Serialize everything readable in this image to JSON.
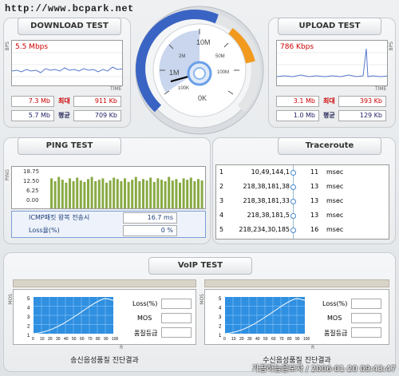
{
  "watermark_url": "http://www.bcpark.net",
  "download": {
    "title": "DOWNLOAD TEST",
    "speed": "5.5 Mbps",
    "axis_bps": "BPS",
    "axis_time": "TIME",
    "cur1": "7.3 Mb",
    "max_label": "최대",
    "max_val": "911 Kb",
    "cur2": "5.7 Mb",
    "avg_label": "평균",
    "avg_val": "709 Kb"
  },
  "upload": {
    "title": "UPLOAD TEST",
    "speed": "786 Kbps",
    "axis_bps": "BPS",
    "axis_time": "TIME",
    "cur1": "3.1 Mb",
    "max_label": "최대",
    "max_val": "393 Kb",
    "cur2": "1.0 Mb",
    "avg_label": "평균",
    "avg_val": "129 Kb"
  },
  "gauge": {
    "ticks": [
      "0K",
      "100K",
      "1M",
      "2M",
      "10M",
      "50M",
      "100M"
    ]
  },
  "ping": {
    "title": "PING TEST",
    "axis": "PING",
    "yticks": [
      "18.75",
      "12.50",
      "6.25",
      "0.00"
    ],
    "icmp_label": "ICMP패킷 왕복 전송시",
    "icmp_value": "16.7 ms",
    "loss_label": "Loss율(%)",
    "loss_value": "0 %"
  },
  "traceroute": {
    "title": "Traceroute",
    "rows": [
      {
        "n": "1",
        "ip": "10,49,144,1",
        "ms": "11",
        "unit": "msec"
      },
      {
        "n": "2",
        "ip": "218,38,181,38",
        "ms": "13",
        "unit": "msec"
      },
      {
        "n": "3",
        "ip": "218,38,181,33",
        "ms": "13",
        "unit": "msec"
      },
      {
        "n": "4",
        "ip": "218,38,181,5",
        "ms": "13",
        "unit": "msec"
      },
      {
        "n": "5",
        "ip": "218,234,30,185",
        "ms": "16",
        "unit": "msec"
      }
    ]
  },
  "voip": {
    "title": "VoIP TEST",
    "left_caption": "송신음성품질 진단결과",
    "right_caption": "수신음성품질 진단결과",
    "axis_mos": "MOS",
    "axis_r": "R",
    "yticks": [
      "5",
      "4",
      "3",
      "2",
      "1"
    ],
    "xticks": [
      "0",
      "10",
      "20",
      "30",
      "40",
      "50",
      "60",
      "70",
      "80",
      "90",
      "100"
    ],
    "loss_label": "Loss(%)",
    "mos_label": "MOS",
    "grade_label": "품질등급"
  },
  "footer": "가끔하늘을보자 / 2006-01-20 09:43:47",
  "colors": {
    "accent_red": "#cc0000",
    "graph_blue": "#6688cc",
    "ping_green": "#88aa44",
    "voip_blue": "#2f8fe0"
  }
}
